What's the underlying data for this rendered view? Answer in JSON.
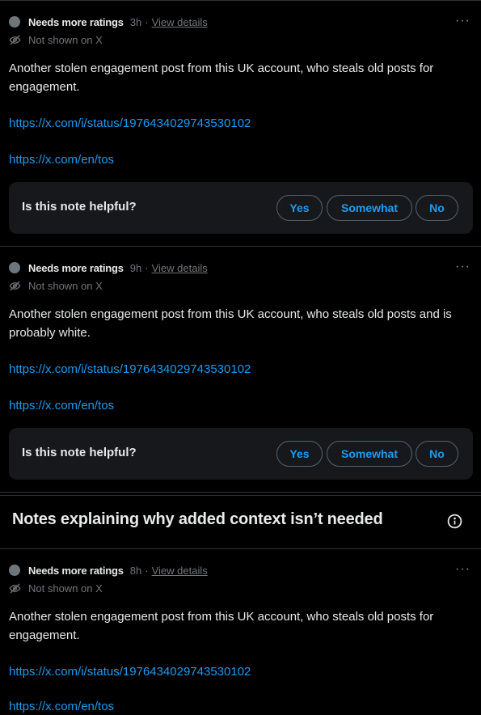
{
  "notes": [
    {
      "status": "Needs more ratings",
      "time": "3h",
      "sep": "·",
      "details": "View details",
      "more": "···",
      "visibility": "Not shown on X",
      "body": "Another stolen engagement post from this UK account, who steals old posts for engagement.",
      "link1": "https://x.com/i/status/1976434029743530102",
      "link2": "https://x.com/en/tos",
      "question": "Is this note helpful?",
      "yes": "Yes",
      "somewhat": "Somewhat",
      "no": "No"
    },
    {
      "status": "Needs more ratings",
      "time": "9h",
      "sep": "·",
      "details": "View details",
      "more": "···",
      "visibility": "Not shown on X",
      "body": "Another stolen engagement post from this UK account, who steals old posts and is probably white.",
      "link1": "https://x.com/i/status/1976434029743530102",
      "link2": "https://x.com/en/tos",
      "question": "Is this note helpful?",
      "yes": "Yes",
      "somewhat": "Somewhat",
      "no": "No"
    },
    {
      "status": "Needs more ratings",
      "time": "8h",
      "sep": "·",
      "details": "View details",
      "more": "···",
      "visibility": "Not shown on X",
      "body": "Another stolen engagement post from this UK account, who steals old posts for engagement.",
      "link1": "https://x.com/i/status/1976434029743530102",
      "link2": "https://x.com/en/tos"
    }
  ],
  "section": {
    "title": "Notes explaining why added context isn’t needed",
    "icon": "info-icon"
  },
  "colors": {
    "background": "#000000",
    "text": "#e7e9ea",
    "muted": "#71767b",
    "link": "#1d9bf0",
    "card": "#16181c",
    "border": "#2f3336"
  }
}
